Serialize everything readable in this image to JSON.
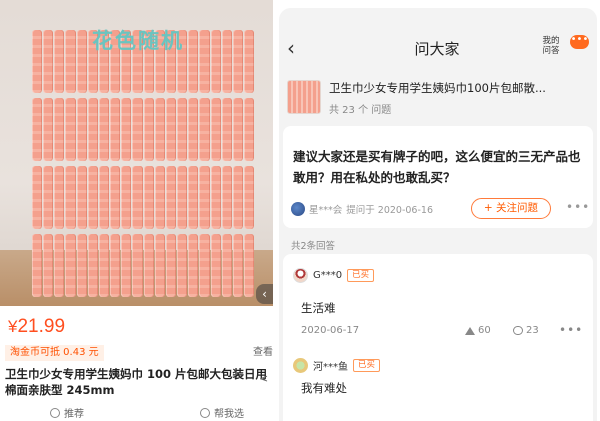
{
  "left": {
    "watermark": "花色随机",
    "price_symbol": "¥",
    "price_value": "21.99",
    "coin_badge": "淘金币可抵 0.43 元",
    "coin_more": "查看",
    "title": "卫生巾少女专用学生姨妈巾 100 片包邮大包装日用棉面亲肤型 245mm",
    "actions": {
      "recommend": "推荐",
      "help": "帮我选"
    }
  },
  "right": {
    "nav": {
      "back_icon": "chevron-left",
      "title": "问大家",
      "my_questions": "我的问答",
      "more_label": "•••"
    },
    "product": {
      "title": "卫生巾少女专用学生姨妈巾100片包邮散...",
      "count": "共 23 个 问题"
    },
    "question": {
      "text": "建议大家还是买有牌子的吧，这么便宜的三无产品也敢用？用在私处的也敢乱买？",
      "asker": "星***会",
      "asked_at": "提问于 2020-06-16",
      "follow_label": "+ 关注问题",
      "more_label": "•••"
    },
    "answers_header": "共2条回答",
    "answers": [
      {
        "user": "G***0",
        "badge": "已买",
        "text": "生活难",
        "date": "2020-06-17",
        "likes": "60",
        "comments": "23",
        "more_label": "•••"
      },
      {
        "user": "河***鱼",
        "badge": "已买",
        "text": "我有难处"
      }
    ]
  },
  "colors": {
    "accent": "#ff5000",
    "pad_pink": "#f4a08d",
    "watermark": "#6ac4c0"
  }
}
